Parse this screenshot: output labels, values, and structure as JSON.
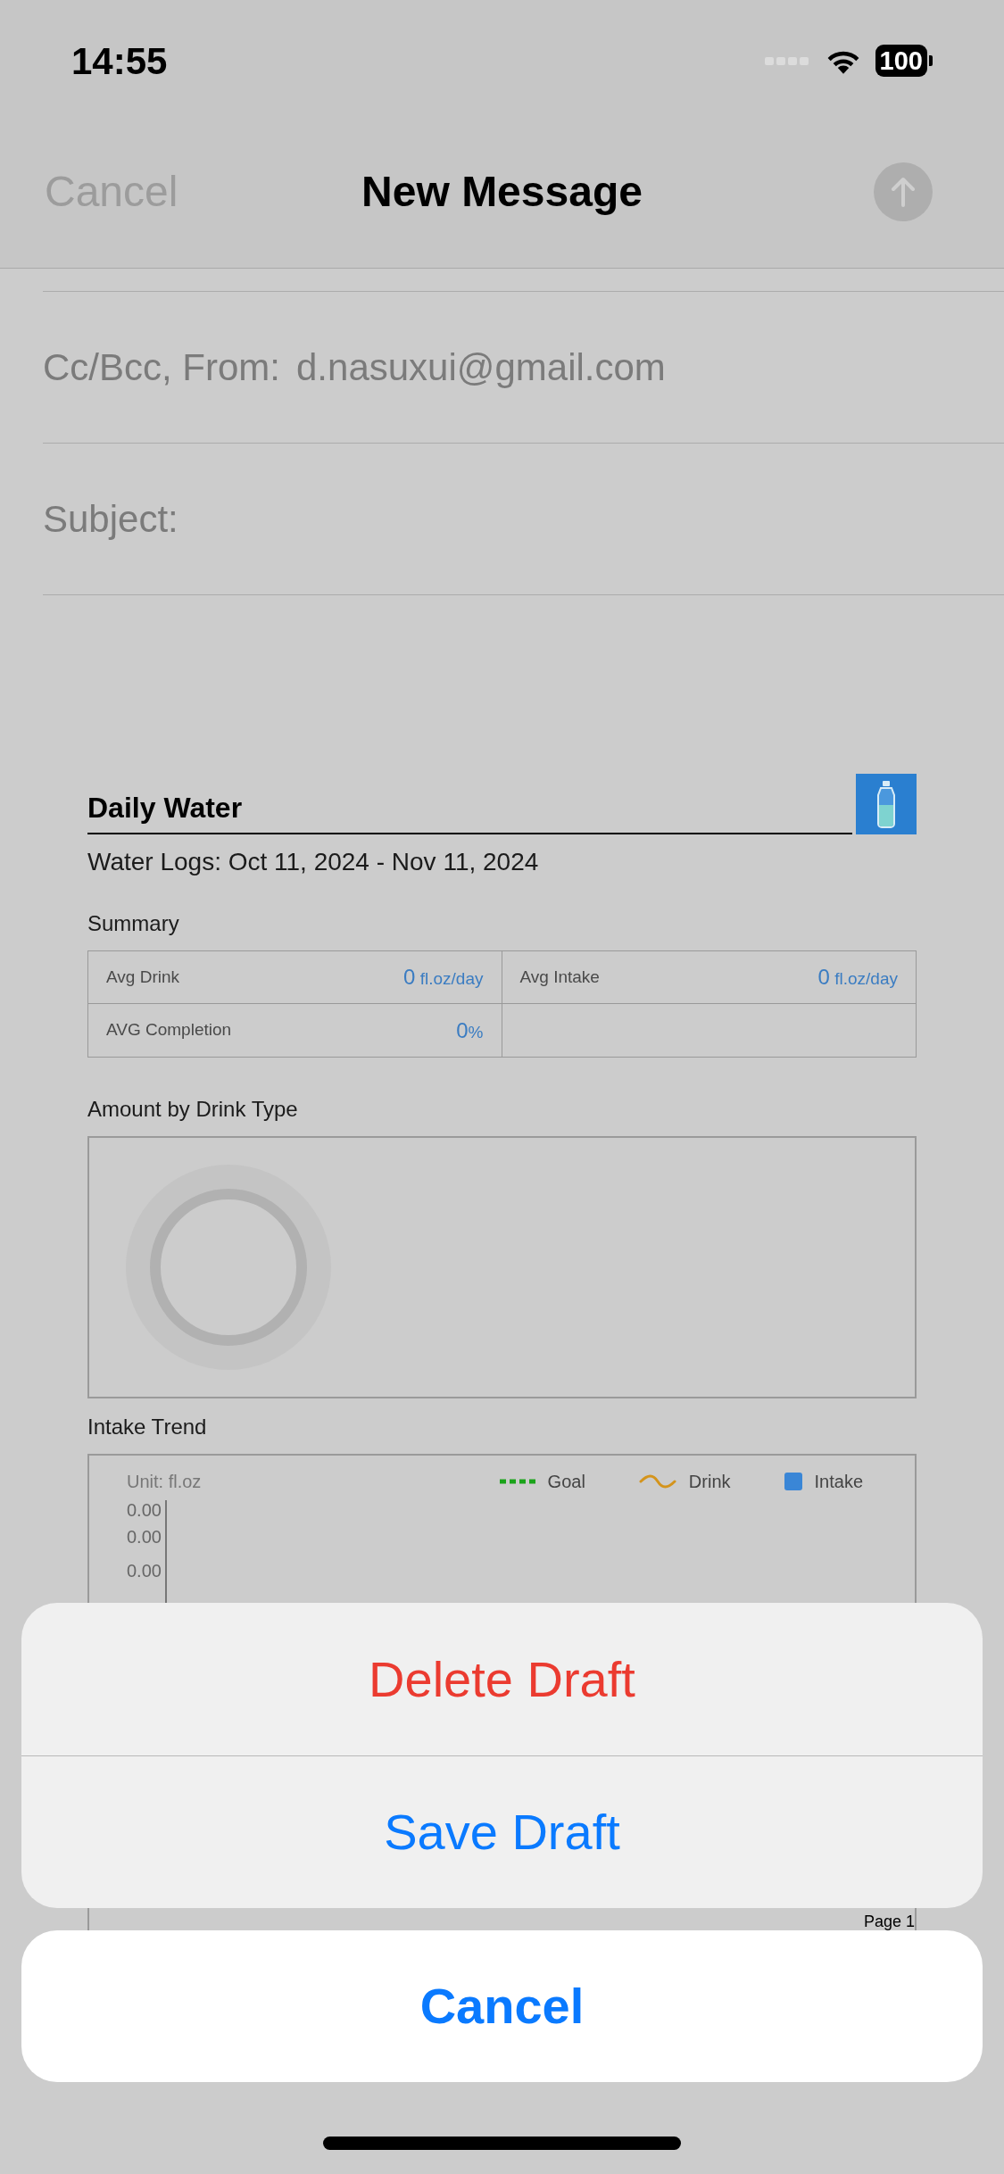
{
  "status_bar": {
    "time": "14:55",
    "battery": "100"
  },
  "nav": {
    "cancel": "Cancel",
    "title": "New Message",
    "send_disabled": true
  },
  "fields": [
    {
      "label": "Cc/Bcc, From:",
      "value": "d.nasuxui@gmail.com"
    },
    {
      "label": "Subject:"
    }
  ],
  "report": {
    "title": "Daily Water",
    "date_range": "Water Logs: Oct 11, 2024 - Nov 11, 2024",
    "summary_title": "Summary",
    "summary": [
      {
        "label": "Avg Drink",
        "value": "0",
        "unit": "fl.oz/day"
      },
      {
        "label": "Avg Intake",
        "value": "0",
        "unit": "fl.oz/day"
      },
      {
        "label": "AVG Completion",
        "value": "0",
        "unit": "%"
      }
    ],
    "drink_type_title": "Amount by Drink Type",
    "trend_title": "Intake Trend",
    "trend": {
      "unit": "Unit: fl.oz",
      "legend": [
        {
          "kind": "dashed",
          "label": "Goal",
          "color": "#1aa31a"
        },
        {
          "kind": "wave",
          "label": "Drink",
          "color": "#d4941c"
        },
        {
          "kind": "square",
          "label": "Intake",
          "color": "#3a86d6"
        }
      ],
      "y_ticks": [
        "0.00",
        "0.00",
        "0.00"
      ]
    },
    "page_label": "Page 1"
  },
  "action_sheet": {
    "actions": [
      {
        "label": "Delete Draft",
        "kind": "destructive"
      },
      {
        "label": "Save Draft",
        "kind": "default"
      }
    ],
    "cancel": "Cancel"
  }
}
